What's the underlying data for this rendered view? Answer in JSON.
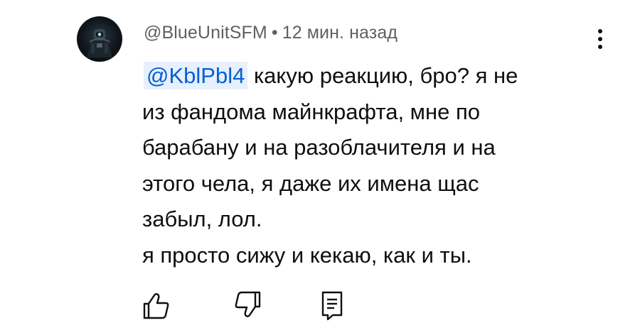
{
  "comment": {
    "author": "@BlueUnitSFM",
    "separator": "•",
    "time": "12 мин. назад",
    "mention": "@KblPbl4",
    "lines": [
      " какую реакцию, бро? я не",
      "из фандома майнкрафта, мне по",
      "барабану и на разоблачителя и на",
      "этого чела, я даже их имена щас",
      "забыл, лол.",
      "я просто сижу и кекаю, как и ты."
    ]
  },
  "icons": {
    "more": "more-vert-icon",
    "like": "thumb-up-icon",
    "dislike": "thumb-down-icon",
    "reply": "reply-icon"
  },
  "colors": {
    "mention_text": "#065fd4",
    "mention_bg": "#e7f0fc",
    "meta_text": "#606060",
    "body_text": "#0f0f0f"
  }
}
